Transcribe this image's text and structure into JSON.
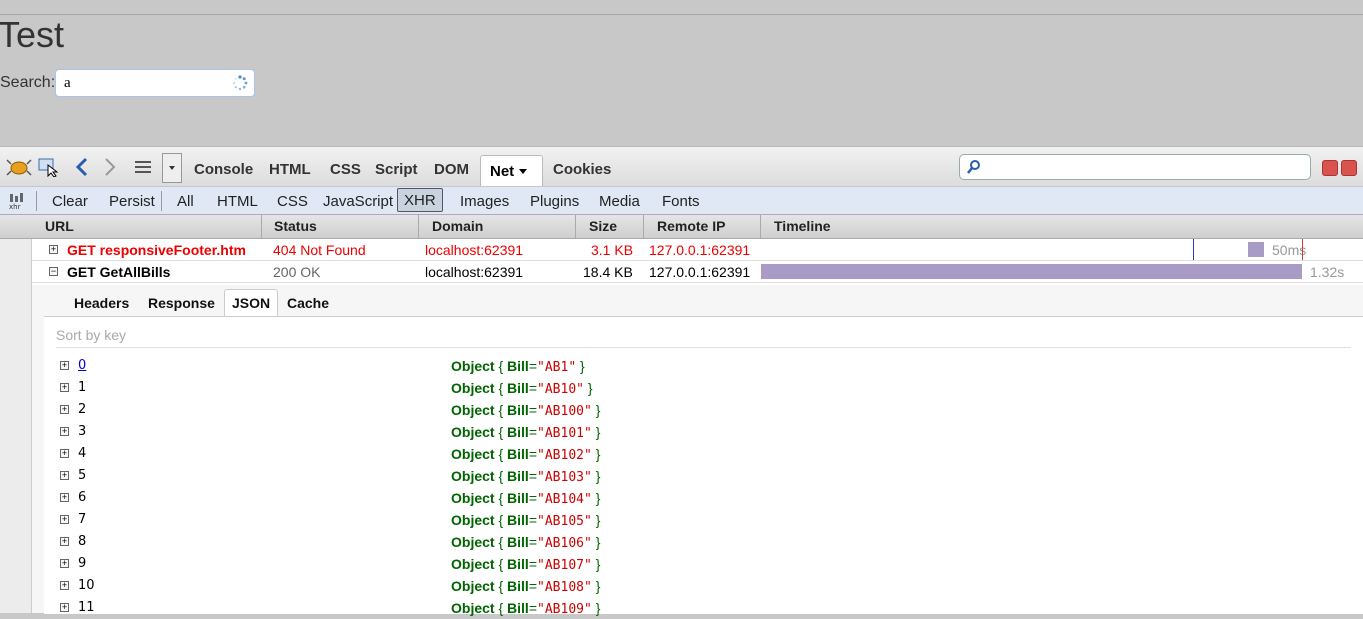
{
  "page": {
    "title": "Test",
    "search_label": "Search:",
    "search_value": "a"
  },
  "firebug": {
    "main_tabs": [
      "Console",
      "HTML",
      "CSS",
      "Script",
      "DOM",
      "Net",
      "Cookies"
    ],
    "active_tab": "Net",
    "net_toolbar": {
      "clear": "Clear",
      "persist": "Persist",
      "filters": [
        "All",
        "HTML",
        "CSS",
        "JavaScript",
        "XHR",
        "Images",
        "Plugins",
        "Media",
        "Fonts"
      ],
      "active_filter": "XHR"
    },
    "columns": [
      "URL",
      "Status",
      "Domain",
      "Size",
      "Remote IP",
      "Timeline"
    ],
    "requests": [
      {
        "url": "GET responsiveFooter.htm",
        "status": "404 Not Found",
        "domain": "localhost:62391",
        "size": "3.1 KB",
        "ip": "127.0.0.1:62391",
        "time": "50ms",
        "error": true,
        "expanded": false
      },
      {
        "url": "GET GetAllBills",
        "status": "200 OK",
        "domain": "localhost:62391",
        "size": "18.4 KB",
        "ip": "127.0.0.1:62391",
        "time": "1.32s",
        "error": false,
        "expanded": true
      }
    ],
    "detail_tabs": [
      "Headers",
      "Response",
      "JSON",
      "Cache"
    ],
    "active_detail_tab": "JSON",
    "sort_by_key": "Sort by key",
    "json_rows": [
      {
        "key": "0",
        "bill": "\"AB1\""
      },
      {
        "key": "1",
        "bill": "\"AB10\""
      },
      {
        "key": "2",
        "bill": "\"AB100\""
      },
      {
        "key": "3",
        "bill": "\"AB101\""
      },
      {
        "key": "4",
        "bill": "\"AB102\""
      },
      {
        "key": "5",
        "bill": "\"AB103\""
      },
      {
        "key": "6",
        "bill": "\"AB104\""
      },
      {
        "key": "7",
        "bill": "\"AB105\""
      },
      {
        "key": "8",
        "bill": "\"AB106\""
      },
      {
        "key": "9",
        "bill": "\"AB107\""
      },
      {
        "key": "10",
        "bill": "\"AB108\""
      },
      {
        "key": "11",
        "bill": "\"AB109\""
      }
    ],
    "object_label": "Object",
    "bill_key": "Bill"
  }
}
